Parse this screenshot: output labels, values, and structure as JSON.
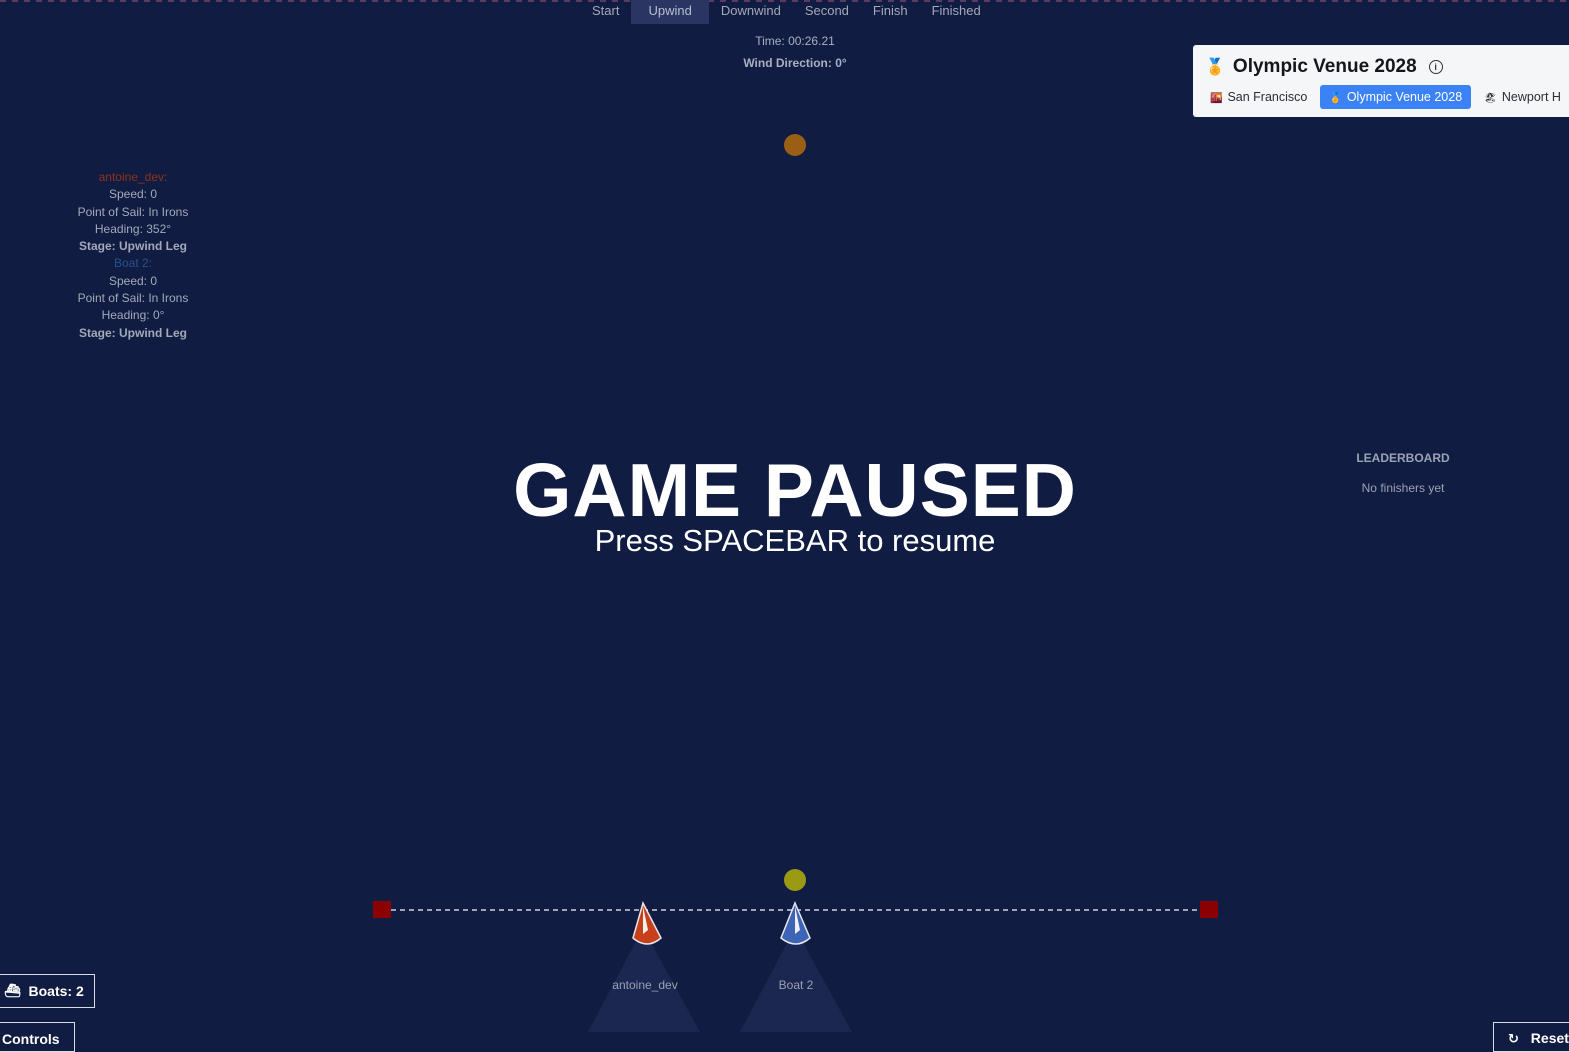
{
  "stages": [
    {
      "label": "Start",
      "active": false
    },
    {
      "label": "Upwind",
      "active": true
    },
    {
      "label": "Downwind",
      "active": false
    },
    {
      "label": "Second",
      "active": false
    },
    {
      "label": "Finish",
      "active": false
    },
    {
      "label": "Finished",
      "active": false
    }
  ],
  "timer": "Time: 00:26.21",
  "wind": "Wind Direction: 0°",
  "boats_stats": [
    {
      "name": "antoine_dev:",
      "speed": "Speed: 0",
      "sail": "Point of Sail: In Irons",
      "heading": "Heading: 352°",
      "stage": "Stage: Upwind Leg"
    },
    {
      "name": "Boat 2:",
      "speed": "Speed: 0",
      "sail": "Point of Sail: In Irons",
      "heading": "Heading: 0°",
      "stage": "Stage: Upwind Leg"
    }
  ],
  "venue": {
    "title": "Olympic Venue 2028",
    "title_icon": "medal-icon",
    "info_icon": "ⓘ",
    "tabs": [
      {
        "label": "San Francisco",
        "icon": "sunset-icon",
        "active": false
      },
      {
        "label": "Olympic Venue 2028",
        "icon": "medal-icon",
        "active": true
      },
      {
        "label": "Newport H",
        "icon": "beach-icon",
        "active": false
      }
    ]
  },
  "leaderboard": {
    "title": "LEADERBOARD",
    "empty": "No finishers yet"
  },
  "overlay": {
    "title": "GAME PAUSED",
    "subtitle": "Press SPACEBAR to resume"
  },
  "course_boats": [
    {
      "label": "antoine_dev",
      "color": "#c8401a"
    },
    {
      "label": "Boat 2",
      "color": "#3d64b5"
    }
  ],
  "buttons": {
    "boats": "Boats: 2",
    "controls": "Controls",
    "reset": "Reset"
  },
  "colors": {
    "background": "#111c43",
    "accent": "#3b82f6",
    "start_line_marks": "#8b0000",
    "upwind_mark": "#9a5f14",
    "start_mark": "#9a9a14"
  }
}
